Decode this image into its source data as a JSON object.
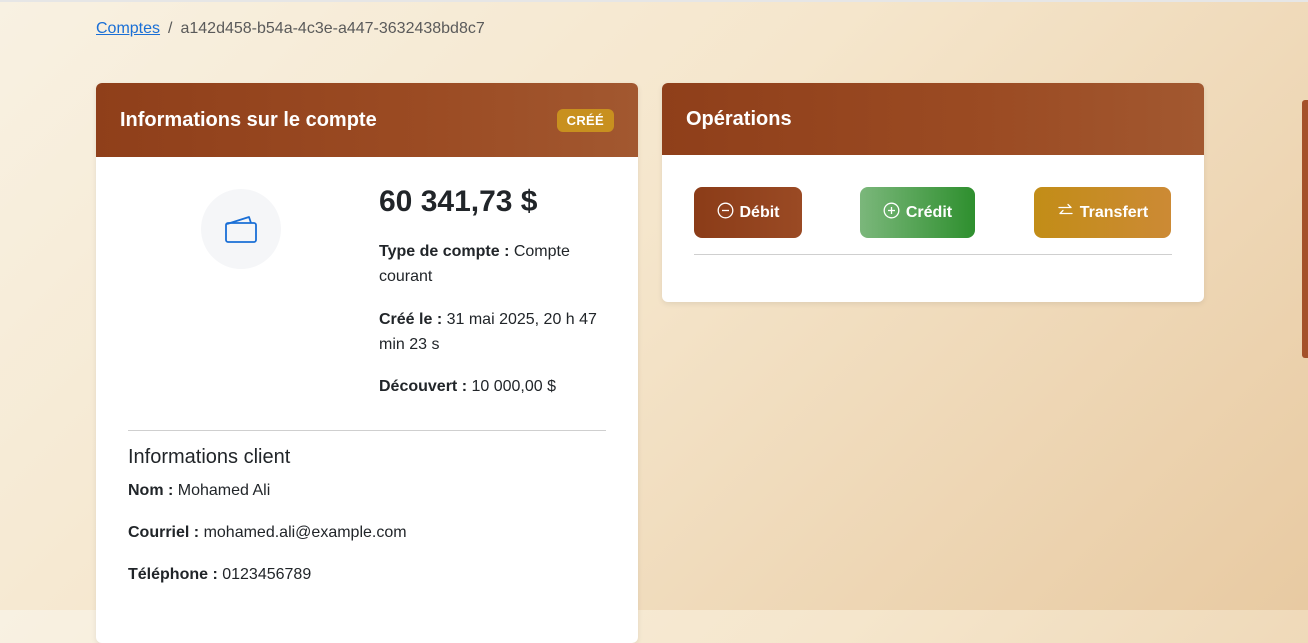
{
  "breadcrumb": {
    "parent_label": "Comptes",
    "separator": "/",
    "current": "a142d458-b54a-4c3e-a447-3632438bd8c7"
  },
  "account_card": {
    "title": "Informations sur le compte",
    "status_badge": "CRÉÉ",
    "icon": "wallet-icon",
    "balance": "60 341,73 $",
    "type_label": "Type de compte :",
    "type_value": "Compte courant",
    "created_label": "Créé le :",
    "created_value": "31 mai 2025, 20 h 47 min 23 s",
    "overdraft_label": "Découvert :",
    "overdraft_value": "10 000,00 $"
  },
  "client": {
    "title": "Informations client",
    "name_label": "Nom :",
    "name_value": "Mohamed Ali",
    "email_label": "Courriel :",
    "email_value": "mohamed.ali@example.com",
    "phone_label": "Téléphone :",
    "phone_value": "0123456789"
  },
  "operations": {
    "title": "Opérations",
    "debit_label": "Débit",
    "credit_label": "Crédit",
    "transfer_label": "Transfert"
  },
  "colors": {
    "header_brown": "#933f1a",
    "badge_gold": "#c8901f",
    "credit_green": "#2e8f2e",
    "link_blue": "#1a6fd6"
  }
}
